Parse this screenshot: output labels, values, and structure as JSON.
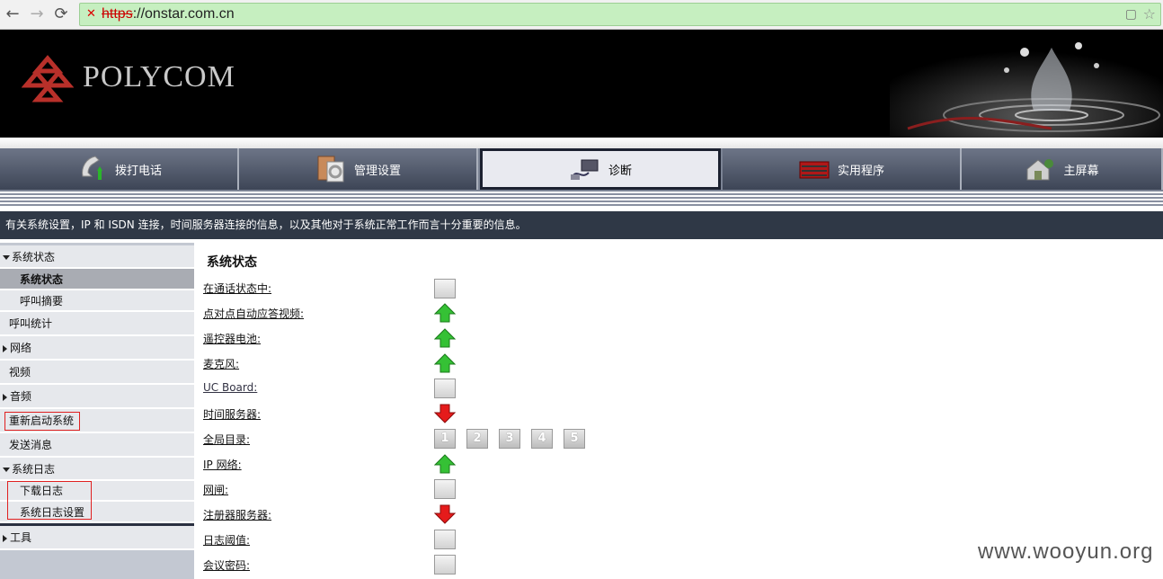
{
  "browser": {
    "back_glyph": "←",
    "forward_glyph": "→",
    "reload_glyph": "⟳",
    "url_scheme": "https",
    "url_rest": "://onstar.com.cn",
    "lock_glyph": "✕",
    "star_glyph": "☆"
  },
  "banner": {
    "brand": "POLYCOM"
  },
  "nav": {
    "tabs": [
      {
        "label": "拨打电话",
        "icon": "phone-icon"
      },
      {
        "label": "管理设置",
        "icon": "settings-icon"
      },
      {
        "label": "诊断",
        "icon": "diagnostics-icon",
        "active": true
      },
      {
        "label": "实用程序",
        "icon": "utilities-icon"
      },
      {
        "label": "主屏幕",
        "icon": "home-screen-icon"
      }
    ]
  },
  "infobar": {
    "text": "有关系统设置，IP 和 ISDN 连接，时间服务器连接的信息，以及其他对于系统正常工作而言十分重要的信息。"
  },
  "sidebar": {
    "items": [
      {
        "label": "系统状态"
      },
      {
        "label": "系统状态"
      },
      {
        "label": "呼叫摘要"
      },
      {
        "label": "呼叫统计"
      },
      {
        "label": "网络"
      },
      {
        "label": "视频"
      },
      {
        "label": "音频"
      },
      {
        "label": "重新启动系统"
      },
      {
        "label": "发送消息"
      },
      {
        "label": "系统日志"
      },
      {
        "label": "下载日志"
      },
      {
        "label": "系统日志设置"
      },
      {
        "label": "工具"
      }
    ]
  },
  "main": {
    "title": "系统状态",
    "rows": [
      {
        "label": "在通话状态中:",
        "status": "gray"
      },
      {
        "label": "点对点自动应答视频:",
        "status": "up"
      },
      {
        "label": "遥控器电池:",
        "status": "up"
      },
      {
        "label": "麦克风:",
        "status": "up"
      },
      {
        "label": "UC Board:",
        "status": "gray"
      },
      {
        "label": "时间服务器:",
        "status": "down"
      },
      {
        "label": "全局目录:",
        "status": "numbers"
      },
      {
        "label": "IP 网络:",
        "status": "up"
      },
      {
        "label": "网闸:",
        "status": "gray"
      },
      {
        "label": "注册器服务器:",
        "status": "down"
      },
      {
        "label": "日志阈值:",
        "status": "gray"
      },
      {
        "label": "会议密码:",
        "status": "gray"
      }
    ],
    "directory_numbers": [
      "1",
      "2",
      "3",
      "4",
      "5"
    ]
  },
  "colors": {
    "status_up": "#2bb52b",
    "status_down": "#e01010",
    "nav_dark": "#3d4556",
    "infobar_bg": "#2f3846"
  },
  "watermark": "www.wooyun.org"
}
